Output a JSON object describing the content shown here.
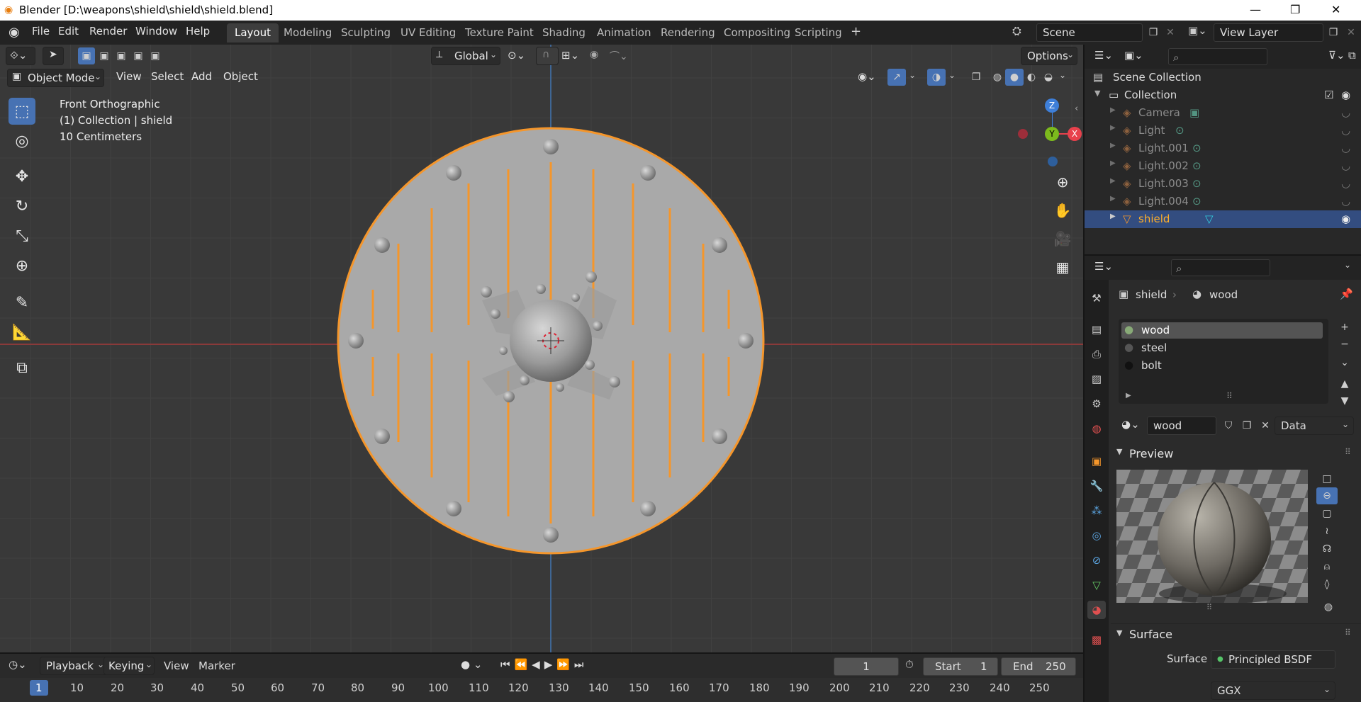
{
  "window": {
    "title": "Blender [D:\\weapons\\shield\\shield\\shield.blend]"
  },
  "menu": [
    "File",
    "Edit",
    "Render",
    "Window",
    "Help"
  ],
  "workspaces": [
    "Layout",
    "Modeling",
    "Sculpting",
    "UV Editing",
    "Texture Paint",
    "Shading",
    "Animation",
    "Rendering",
    "Compositing",
    "Scripting"
  ],
  "scene": {
    "name": "Scene",
    "view_layer": "View Layer"
  },
  "toolbar": {
    "orientation": "Global",
    "options": "Options"
  },
  "viewport": {
    "mode": "Object Mode",
    "menus": [
      "View",
      "Select",
      "Add",
      "Object"
    ],
    "info": [
      "Front Orthographic",
      "(1) Collection | shield",
      "10 Centimeters"
    ],
    "gizmo": {
      "z": "Z",
      "y": "Y",
      "x": "X"
    }
  },
  "outliner": {
    "root": "Scene Collection",
    "collection": "Collection",
    "items": [
      "Camera",
      "Light",
      "Light.001",
      "Light.002",
      "Light.003",
      "Light.004",
      "shield"
    ]
  },
  "properties": {
    "object": "shield",
    "material": "wood",
    "slots": [
      "wood",
      "steel",
      "bolt"
    ],
    "material_field": "wood",
    "link": "Data",
    "preview_label": "Preview",
    "surface_panel": "Surface",
    "surface_label": "Surface",
    "surface_value": "Principled BSDF",
    "distribution": "GGX"
  },
  "timeline": {
    "menus": [
      "Playback",
      "Keying",
      "View",
      "Marker"
    ],
    "current_frame": "1",
    "start_label": "Start",
    "start": "1",
    "end_label": "End",
    "end": "250",
    "ticks": [
      "1",
      "10",
      "20",
      "30",
      "40",
      "50",
      "60",
      "70",
      "80",
      "90",
      "100",
      "110",
      "120",
      "130",
      "140",
      "150",
      "160",
      "170",
      "180",
      "190",
      "200",
      "210",
      "220",
      "230",
      "240",
      "250"
    ]
  },
  "colors": {
    "accent": "#4772b3",
    "selection": "#f5962b",
    "mesh": "#a7a7a7",
    "viewport_bg": "#393939"
  }
}
